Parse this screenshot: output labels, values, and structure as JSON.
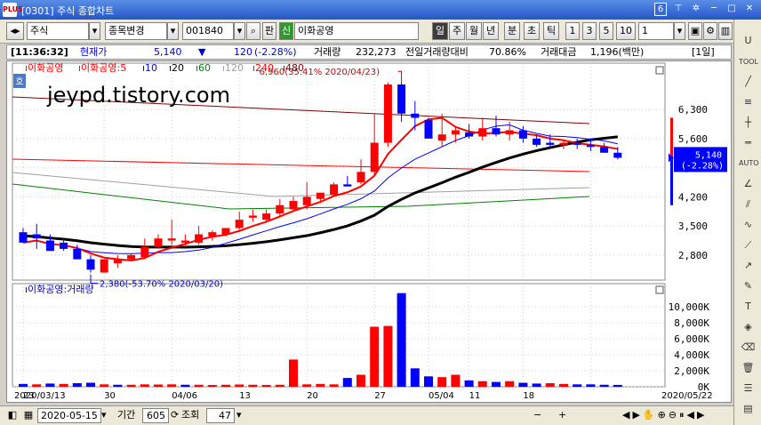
{
  "window": {
    "code": "[0301]",
    "title": "주식 종합차트",
    "page_num": "6",
    "btn_pin": "⊤",
    "btn_menu": "✲",
    "btn_min": "─",
    "btn_max": "□",
    "btn_close": "✕"
  },
  "toolbar": {
    "market": "주식",
    "change_stock": "종목변경",
    "code": "001840",
    "search_icon": "🔍",
    "pan": "판",
    "new_badge": "신",
    "stock_name": "이화공영",
    "periods": [
      "일",
      "주",
      "월",
      "년",
      "분",
      "초",
      "틱"
    ],
    "selected_period": "일",
    "nums": [
      "1",
      "3",
      "5",
      "10"
    ],
    "count": "1"
  },
  "status": {
    "time": "[11:36:32]",
    "price_label": "현재가",
    "price": "5,140",
    "arrow": "▼",
    "change": "120",
    "change_pct": "(-2.28%)",
    "volume_label": "거래량",
    "volume": "232,273",
    "prev_ratio_label": "전일거래량대비",
    "prev_ratio": "70.86%",
    "amount_label": "거래대금",
    "amount": "1,196(백만)",
    "period_badge": "[1일]"
  },
  "colors": {
    "up": "#ff0000",
    "down": "#0000ff",
    "ma5": "#ff0000",
    "ma10": "#0000ff",
    "ma20": "#000000",
    "ma60": "#008000",
    "ma120": "#a0a0a0",
    "ma240": "#ff0000",
    "ma480": "#800000"
  },
  "chart_data": [
    {
      "type": "candlestick",
      "legend": [
        {
          "name": "이화공영",
          "color": "#ff0000"
        },
        {
          "name": "이화공영:5",
          "color": "#ff0000"
        },
        {
          "name": "10",
          "color": "#0000ff"
        },
        {
          "name": "20",
          "color": "#000000"
        },
        {
          "name": "60",
          "color": "#008000"
        },
        {
          "name": "120",
          "color": "#a0a0a0"
        },
        {
          "name": "240",
          "color": "#ff0000"
        },
        {
          "name": "480",
          "color": "#800000"
        }
      ],
      "hoga_label": "호",
      "watermark": "jeypd.tistory.com",
      "yticks": [
        2800,
        3500,
        4200,
        4900,
        5600,
        6300
      ],
      "ytick_labels": [
        "2,800",
        "3,500",
        "4,200",
        "4,900",
        "5,600",
        "6,300"
      ],
      "ylim": [
        2200,
        7200
      ],
      "xtick_labels": [
        "2020/03/13",
        "23",
        "30",
        "04/06",
        "13",
        "20",
        "27",
        "05/04",
        "11",
        "18",
        "2020/05/22"
      ],
      "dates": [
        "03/13",
        "03/16",
        "03/17",
        "03/18",
        "03/19",
        "03/20",
        "03/23",
        "03/24",
        "03/25",
        "03/26",
        "03/27",
        "03/30",
        "03/31",
        "04/01",
        "04/02",
        "04/03",
        "04/06",
        "04/07",
        "04/08",
        "04/09",
        "04/10",
        "04/13",
        "04/14",
        "04/16",
        "04/17",
        "04/20",
        "04/21",
        "04/22",
        "04/23",
        "04/24",
        "04/27",
        "04/28",
        "04/29",
        "05/04",
        "05/06",
        "05/07",
        "05/08",
        "05/11",
        "05/12",
        "05/13",
        "05/14",
        "05/15",
        "05/18",
        "05/19",
        "05/20"
      ],
      "open": [
        3350,
        3300,
        3150,
        3100,
        2950,
        2700,
        2380,
        2600,
        2700,
        2750,
        3000,
        3150,
        3100,
        3100,
        3250,
        3300,
        3450,
        3700,
        3650,
        3800,
        3900,
        4000,
        4150,
        4250,
        4500,
        4550,
        4800,
        5500,
        6900,
        6200,
        6050,
        5550,
        5700,
        5750,
        5650,
        5850,
        5700,
        5800,
        5600,
        5500,
        5450,
        5500,
        5450,
        5400,
        5260
      ],
      "high": [
        3450,
        3550,
        3300,
        3200,
        3050,
        2800,
        2700,
        2800,
        2850,
        3200,
        3300,
        3650,
        3300,
        3500,
        3400,
        3450,
        3850,
        3900,
        3900,
        4150,
        4200,
        4550,
        4300,
        4550,
        4700,
        5100,
        6200,
        6950,
        6960,
        6500,
        6100,
        6200,
        5900,
        5950,
        6100,
        6150,
        6000,
        5900,
        5700,
        5700,
        5550,
        5600,
        5600,
        5500,
        5400
      ],
      "low": [
        3250,
        2950,
        2950,
        2900,
        2700,
        2380,
        2400,
        2500,
        2650,
        2700,
        2950,
        3050,
        3000,
        3050,
        3150,
        3250,
        3400,
        3600,
        3600,
        3750,
        3850,
        3900,
        4050,
        4200,
        4450,
        4500,
        4700,
        5400,
        6000,
        5800,
        5700,
        5400,
        5500,
        5600,
        5550,
        5650,
        5550,
        5500,
        5400,
        5400,
        5350,
        5350,
        5300,
        5300,
        5100
      ],
      "close": [
        3100,
        3200,
        2900,
        2950,
        2700,
        2450,
        2700,
        2700,
        2800,
        3000,
        3200,
        3200,
        3150,
        3300,
        3350,
        3450,
        3650,
        3750,
        3800,
        4000,
        4100,
        4200,
        4300,
        4500,
        4450,
        4800,
        5500,
        6900,
        6200,
        6100,
        5600,
        5700,
        5800,
        5650,
        5850,
        5700,
        5800,
        5600,
        5450,
        5450,
        5500,
        5450,
        5400,
        5260,
        5140
      ],
      "annotations": [
        {
          "text": "6,960(35.41% 2020/04/23)",
          "x": "04/23",
          "y": 6960
        },
        {
          "text": "2,380(-53.70% 2020/03/20)",
          "x": "03/20",
          "y": 2380
        }
      ],
      "price_tag": {
        "price": "5,140",
        "pct": "(-2.28%)"
      }
    },
    {
      "type": "bar",
      "title": "이화공영:거래량",
      "yticks_labels": [
        "0K",
        "2,000K",
        "4,000K",
        "6,000K",
        "8,000K",
        "10,000K"
      ],
      "yticks": [
        0,
        2000,
        4000,
        6000,
        8000,
        10000
      ],
      "ylim": [
        0,
        12000
      ],
      "volume": [
        350,
        300,
        400,
        350,
        450,
        500,
        300,
        250,
        250,
        300,
        280,
        300,
        250,
        250,
        220,
        250,
        280,
        250,
        230,
        250,
        3400,
        300,
        350,
        300,
        1100,
        1500,
        7500,
        7600,
        11700,
        2300,
        1300,
        1200,
        1500,
        800,
        700,
        600,
        700,
        500,
        400,
        450,
        350,
        300,
        300,
        250,
        232
      ],
      "volume_up": [
        false,
        true,
        false,
        true,
        false,
        false,
        true,
        false,
        true,
        true,
        true,
        true,
        false,
        true,
        true,
        true,
        true,
        true,
        true,
        true,
        true,
        true,
        true,
        true,
        false,
        true,
        true,
        true,
        false,
        false,
        false,
        true,
        true,
        false,
        true,
        false,
        true,
        false,
        false,
        true,
        true,
        false,
        false,
        false,
        false
      ]
    }
  ],
  "bottom": {
    "date": "2020-05-15",
    "period_label": "기간",
    "period_value": "605",
    "query_label": "조회",
    "query_value": "47",
    "plus": "+",
    "minus": "−"
  },
  "sidebar": {
    "tool_label": "TOOL",
    "auto_label": "AUTO"
  }
}
